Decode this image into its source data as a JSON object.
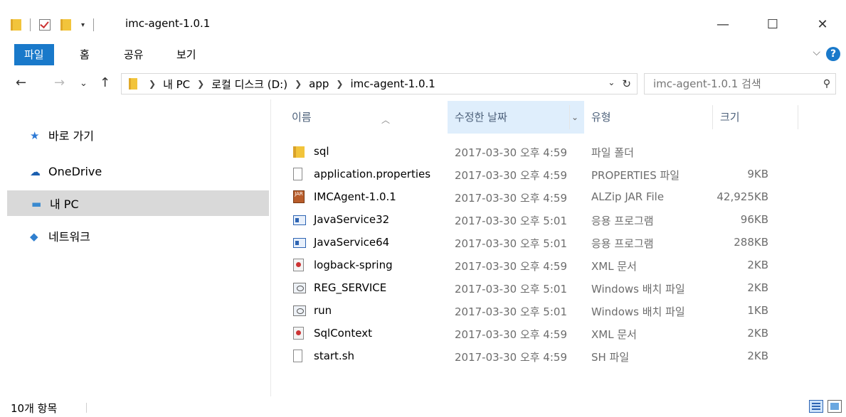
{
  "window": {
    "title": "imc-agent-1.0.1",
    "controls": {
      "minimize": "—",
      "maximize": "☐",
      "close": "✕"
    }
  },
  "ribbon": {
    "tabs": [
      {
        "label": "파일",
        "active": true
      },
      {
        "label": "홈"
      },
      {
        "label": "공유"
      },
      {
        "label": "보기"
      }
    ],
    "help": "?"
  },
  "address": {
    "crumbs": [
      "내 PC",
      "로컬 디스크 (D:)",
      "app",
      "imc-agent-1.0.1"
    ]
  },
  "search": {
    "placeholder": "imc-agent-1.0.1 검색"
  },
  "nav": {
    "items": [
      {
        "label": "바로 가기",
        "icon": "star-icon"
      },
      {
        "label": "OneDrive",
        "icon": "cloud-icon"
      },
      {
        "label": "내 PC",
        "icon": "computer-icon",
        "selected": true
      },
      {
        "label": "네트워크",
        "icon": "network-icon"
      }
    ]
  },
  "columns": {
    "name": "이름",
    "date": "수정한 날짜",
    "type": "유형",
    "size": "크기"
  },
  "files": [
    {
      "name": "sql",
      "date": "2017-03-30 오후 4:59",
      "type": "파일 폴더",
      "size": "",
      "icon": "folder-icon"
    },
    {
      "name": "application.properties",
      "date": "2017-03-30 오후 4:59",
      "type": "PROPERTIES 파일",
      "size": "9KB",
      "icon": "file-icon"
    },
    {
      "name": "IMCAgent-1.0.1",
      "date": "2017-03-30 오후 4:59",
      "type": "ALZip JAR File",
      "size": "42,925KB",
      "icon": "jar-icon"
    },
    {
      "name": "JavaService32",
      "date": "2017-03-30 오후 5:01",
      "type": "응용 프로그램",
      "size": "96KB",
      "icon": "exe-icon"
    },
    {
      "name": "JavaService64",
      "date": "2017-03-30 오후 5:01",
      "type": "응용 프로그램",
      "size": "288KB",
      "icon": "exe-icon"
    },
    {
      "name": "logback-spring",
      "date": "2017-03-30 오후 4:59",
      "type": "XML 문서",
      "size": "2KB",
      "icon": "xml-icon"
    },
    {
      "name": "REG_SERVICE",
      "date": "2017-03-30 오후 5:01",
      "type": "Windows 배치 파일",
      "size": "2KB",
      "icon": "batch-icon"
    },
    {
      "name": "run",
      "date": "2017-03-30 오후 5:01",
      "type": "Windows 배치 파일",
      "size": "1KB",
      "icon": "batch-icon"
    },
    {
      "name": "SqlContext",
      "date": "2017-03-30 오후 4:59",
      "type": "XML 문서",
      "size": "2KB",
      "icon": "xml-icon"
    },
    {
      "name": "start.sh",
      "date": "2017-03-30 오후 4:59",
      "type": "SH 파일",
      "size": "2KB",
      "icon": "file-icon"
    }
  ],
  "status": {
    "count": "10개 항목"
  },
  "colors": {
    "accent": "#1979ca",
    "selected": "#d9d9d9",
    "sortedHeader": "#dfeefc"
  }
}
